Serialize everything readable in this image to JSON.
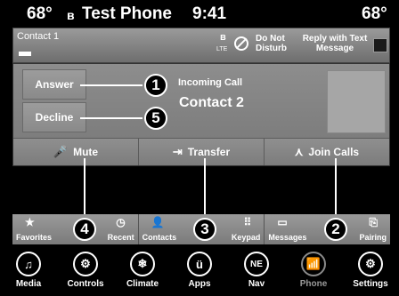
{
  "status_bar": {
    "temp_left": "68°",
    "bt_glyph": "ʙ",
    "phone_name": "Test Phone",
    "time": "9:41",
    "temp_right": "68°"
  },
  "contact_strip": {
    "name": "Contact 1",
    "network": "LTE",
    "do_not_disturb": "Do Not Disturb",
    "reply_with_text": "Reply with Text Message"
  },
  "call": {
    "answer_label": "Answer",
    "decline_label": "Decline",
    "incoming_label": "Incoming Call",
    "contact_name": "Contact 2",
    "actions": [
      {
        "label": "Mute",
        "icon": "mic-mute-icon"
      },
      {
        "label": "Transfer",
        "icon": "transfer-icon"
      },
      {
        "label": "Join Calls",
        "icon": "join-calls-icon"
      }
    ]
  },
  "callouts": [
    "1",
    "5",
    "4",
    "3",
    "2"
  ],
  "tabs": [
    {
      "left": "Favorites",
      "right": "Recent"
    },
    {
      "left": "Contacts",
      "right": "Keypad"
    },
    {
      "left": "Messages",
      "right": "Pairing"
    }
  ],
  "dock": [
    {
      "label": "Media",
      "icon": "music-note-icon"
    },
    {
      "label": "Controls",
      "icon": "controls-icon"
    },
    {
      "label": "Climate",
      "icon": "climate-icon"
    },
    {
      "label": "Apps",
      "icon": "apps-icon",
      "glyph": "ü"
    },
    {
      "label": "Nav",
      "icon": "nav-icon",
      "glyph": "NE"
    },
    {
      "label": "Phone",
      "icon": "phone-signal-icon"
    },
    {
      "label": "Settings",
      "icon": "gear-icon"
    }
  ]
}
